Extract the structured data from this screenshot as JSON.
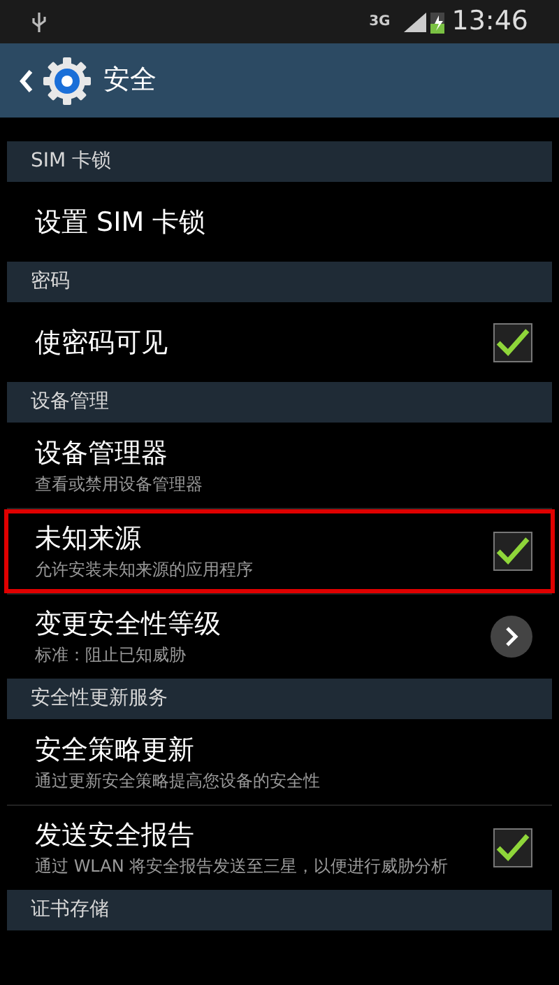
{
  "status_bar": {
    "network": "3G",
    "time": "13:46"
  },
  "action_bar": {
    "title": "安全"
  },
  "list": [
    {
      "kind": "header",
      "title": "SIM 卡锁"
    },
    {
      "kind": "item",
      "title": "设置 SIM 卡锁"
    },
    {
      "kind": "header",
      "title": "密码"
    },
    {
      "kind": "checkbox",
      "title": "使密码可见",
      "checked": true
    },
    {
      "kind": "header",
      "title": "设备管理"
    },
    {
      "kind": "item",
      "title": "设备管理器",
      "subtitle": "查看或禁用设备管理器"
    },
    {
      "kind": "checkbox",
      "title": "未知来源",
      "subtitle": "允许安装未知来源的应用程序",
      "checked": true,
      "highlighted": true
    },
    {
      "kind": "arrow",
      "title": "变更安全性等级",
      "subtitle": "标准：阻止已知威胁"
    },
    {
      "kind": "header",
      "title": "安全性更新服务"
    },
    {
      "kind": "item",
      "title": "安全策略更新",
      "subtitle": "通过更新安全策略提高您设备的安全性"
    },
    {
      "kind": "checkbox",
      "title": "发送安全报告",
      "subtitle": "通过 WLAN 将安全报告发送至三星，以便进行威胁分析",
      "checked": true
    },
    {
      "kind": "header",
      "title": "证书存储"
    }
  ]
}
